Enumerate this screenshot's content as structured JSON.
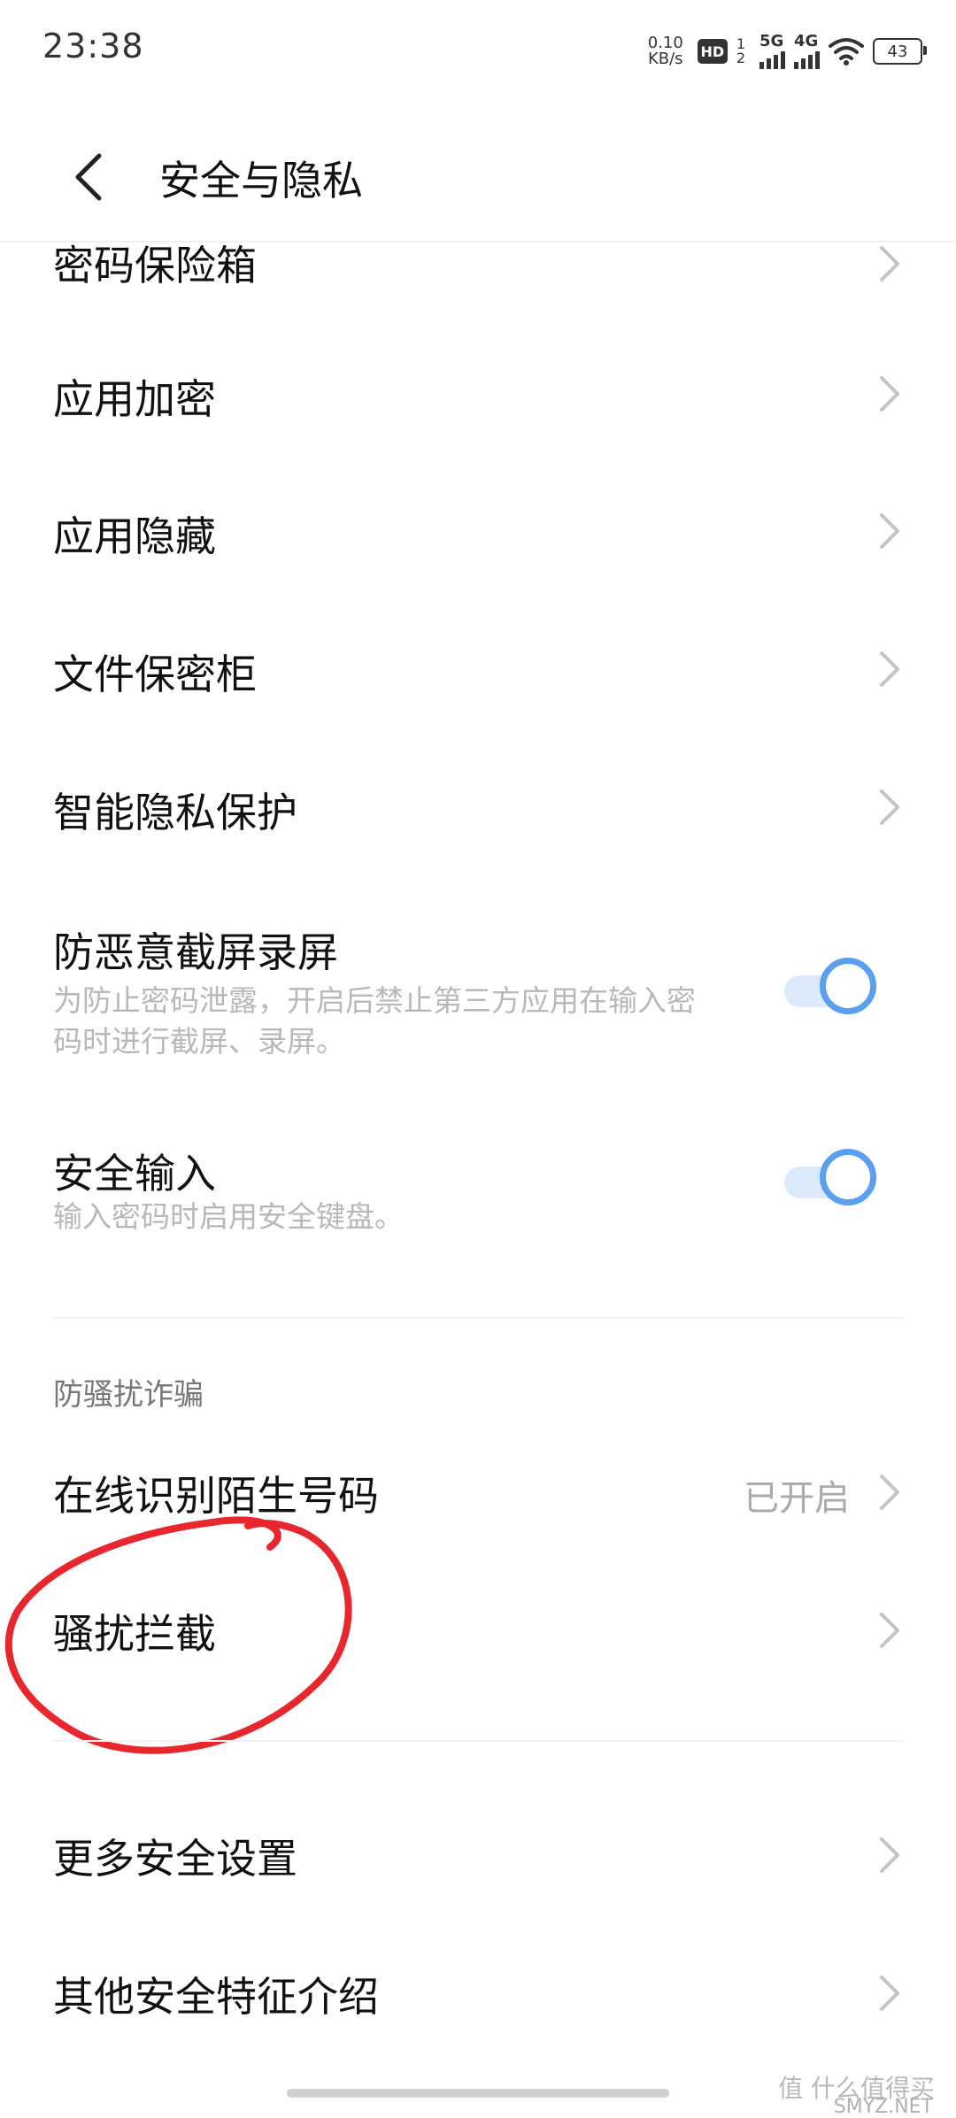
{
  "status": {
    "time": "23:38",
    "net_speed_value": "0.10",
    "net_speed_unit": "KB/s",
    "hd": "HD",
    "sim1": "1",
    "sim2": "2",
    "signal1_label": "5G",
    "signal2_label": "4G",
    "battery": "43"
  },
  "header": {
    "title": "安全与隐私"
  },
  "items": {
    "password_vault": "密码保险箱",
    "app_lock": "应用加密",
    "app_hide": "应用隐藏",
    "file_safe": "文件保密柜",
    "smart_privacy": "智能隐私保护",
    "anti_screenshot_title": "防恶意截屏录屏",
    "anti_screenshot_desc_line1": "为防止密码泄露，开启后禁止第三方应用在输入密",
    "anti_screenshot_desc_line2": "码时进行截屏、录屏。",
    "secure_input_title": "安全输入",
    "secure_input_desc": "输入密码时启用安全键盘。",
    "section_anti_fraud": "防骚扰诈骗",
    "online_identify": "在线识别陌生号码",
    "online_identify_value": "已开启",
    "harass_block": "骚扰拦截",
    "more_settings": "更多安全设置",
    "other_features": "其他安全特征介绍"
  },
  "toggles": {
    "anti_screenshot_on": true,
    "secure_input_on": true
  },
  "watermark": {
    "text": "值 什么值得买",
    "sub": "SMYZ.NET"
  },
  "colors": {
    "accent": "#5aa0ee",
    "annotation": "#e8262e"
  }
}
